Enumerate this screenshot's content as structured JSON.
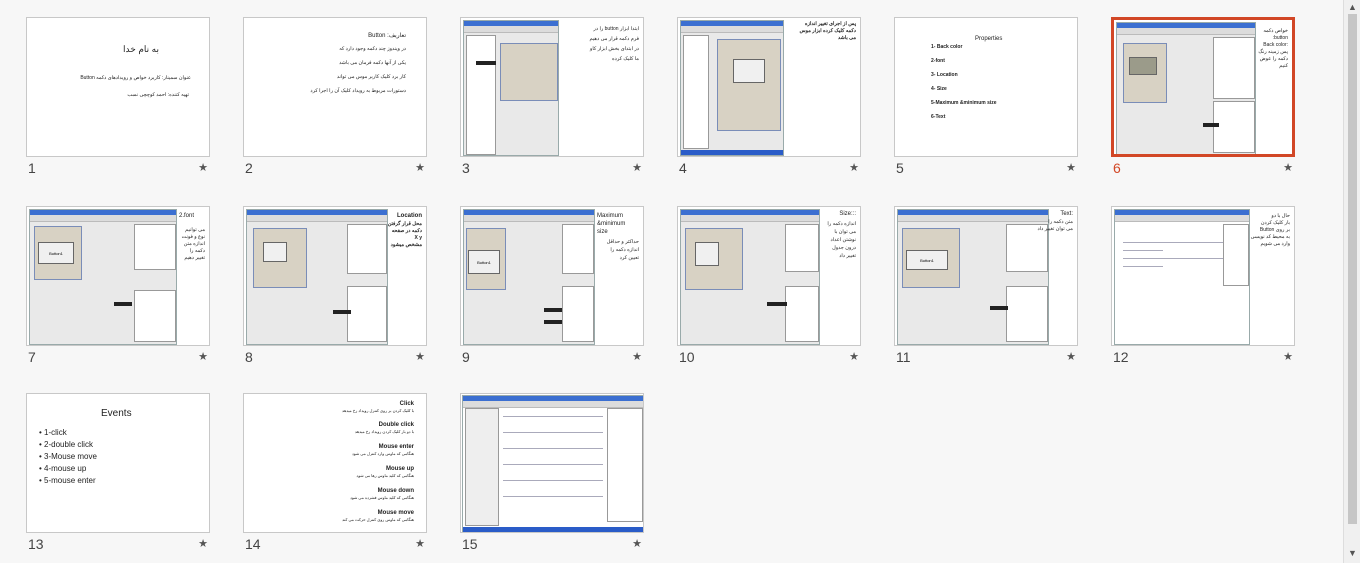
{
  "slides": [
    {
      "number": "1",
      "lines": [
        "به نام خدا",
        "عنوان سمینار: کاربرد خواص و رویدادهای دکمه Button",
        "تهیه کننده: احمد کوچچی نسب"
      ]
    },
    {
      "number": "2",
      "lines": [
        "تعاریف: Button",
        "در ویندوز چند دکمه وجود دارد که",
        "یکی از آنها دکمه فرمان می باشد",
        "کار برد کلیک کاربر موس می تواند",
        "دستورات مربوط به رویداد کلیک آن را اجرا کرد"
      ]
    },
    {
      "number": "3",
      "lines": [
        "ابتدا ابزار button را در",
        "فرم دکمه قرار می دهیم",
        "در ابتدای بخش ابزار کاو",
        "ما کلیک کرده"
      ]
    },
    {
      "number": "4",
      "lines": [
        "پس از اجرای تغییر اندازه",
        "دکمه کلیک کرده ابزار موس",
        "می باشد"
      ]
    },
    {
      "number": "5",
      "lines": [
        "Properties",
        "1- Back color",
        "2-font",
        "3- Location",
        "4- Size",
        "5-Maximum &minimum size",
        "6-Text"
      ]
    },
    {
      "number": "6",
      "lines": [
        "خواص دکمه",
        "button:",
        "Back color:",
        "پس زمینه رنگ",
        "دکمه را عوض",
        "کنیم"
      ]
    },
    {
      "number": "7",
      "lines": [
        "2.font",
        "می توانیم",
        "نوع و فونت",
        "اندازه متن",
        "دکمه را",
        "تغییر دهیم"
      ],
      "button": "Button1"
    },
    {
      "number": "8",
      "lines": [
        "Location",
        "محل قرار گرفتن",
        "دکمه در صفحه",
        "X y",
        "مشخص میشود"
      ]
    },
    {
      "number": "9",
      "lines": [
        "Maximum",
        "&minimum",
        "size",
        "حداکثر و حداقل",
        "اندازه دکمه را",
        "تعیین کرد"
      ],
      "button": "Button1"
    },
    {
      "number": "10",
      "lines": [
        "Size:::",
        "اندازه دکمه را",
        "می توان با",
        "نوشتن اعداد",
        "درون جدول",
        "تغییر داد"
      ]
    },
    {
      "number": "11",
      "lines": [
        "Text:",
        "متن دکمه را",
        "می توان تغییر داد"
      ],
      "button": "Button1"
    },
    {
      "number": "12",
      "lines": [
        "حال با دو",
        "بار کلیک کردن",
        "بر روی Button",
        "به محیط کد نویسی",
        "وارد می شویم"
      ]
    },
    {
      "number": "13",
      "lines": [
        "Events"
      ],
      "bullets": [
        "1-click",
        "2-double click",
        "3-Mouse move",
        "4-mouse up",
        "5-mouse enter"
      ]
    },
    {
      "number": "14",
      "lines": [
        "Click",
        "با کلیک کردن بر روی کنترل رویداد رخ میدهد",
        "Double click",
        "با دو بار کلیک کردن رویداد رخ میدهد",
        "Mouse enter",
        "هنگامی که ماوس وارد کنترل می شود",
        "Mouse up",
        "هنگامی که کلید ماوس رها می شود",
        "Mouse down",
        "هنگامی که کلید ماوس فشرده می شود",
        "Mouse move",
        "هنگامی که ماوس روی کنترل حرکت می کند"
      ]
    },
    {
      "number": "15",
      "lines": []
    }
  ],
  "selected_slide": "6",
  "star_icon": "★",
  "scroll": {
    "up": "▲",
    "down": "▼"
  }
}
